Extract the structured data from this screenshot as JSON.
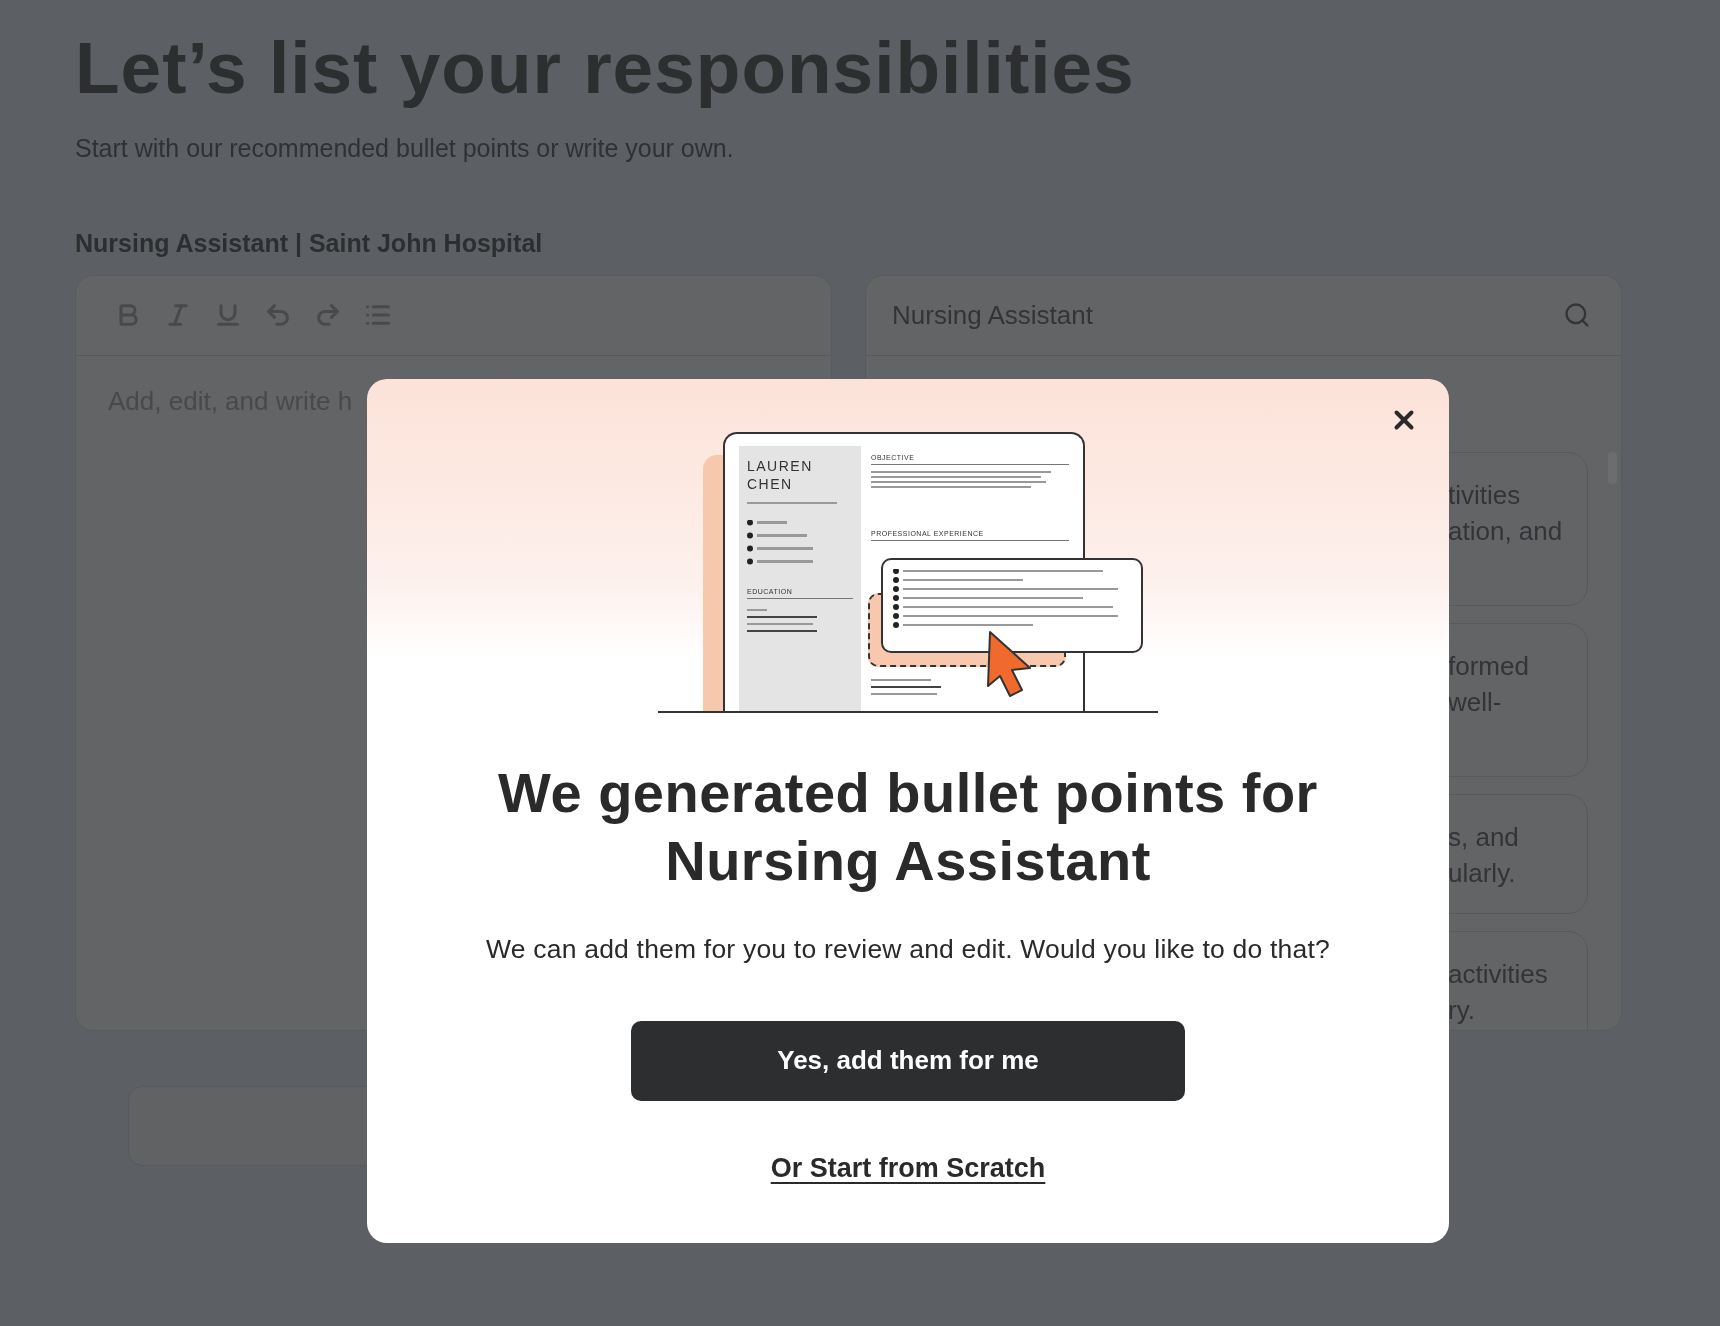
{
  "page": {
    "title": "Let’s list your responsibilities",
    "subtitle": "Start with our recommended bullet points or write your own.",
    "job_label": "Nursing Assistant | Saint John Hospital"
  },
  "editor": {
    "toolbar": [
      {
        "kind": "bold"
      },
      {
        "kind": "italic"
      },
      {
        "kind": "underline"
      },
      {
        "kind": "undo"
      },
      {
        "kind": "redo"
      },
      {
        "kind": "list"
      }
    ],
    "placeholder": "Add, edit, and write h"
  },
  "suggestions": {
    "search_value": "Nursing Assistant",
    "cards": [
      {
        "lines": [
          "tivities",
          "ation, and"
        ]
      },
      {
        "lines": [
          "formed",
          "well-"
        ]
      },
      {
        "lines": [
          "s, and",
          "ularly."
        ]
      },
      {
        "lines": [
          "activities",
          "ry."
        ]
      }
    ]
  },
  "modal": {
    "illustration": {
      "name_lines": [
        "LAUREN",
        "CHEN"
      ],
      "education_heading": "EDUCATION",
      "objective_heading": "OBJECTIVE",
      "experience_heading": "PROFESSIONAL EXPERIENCE"
    },
    "title": "We generated bullet points for Nursing Assistant",
    "message": "We can add them for you to review and edit. Would you like to do that?",
    "primary_button": "Yes, add them for me",
    "secondary_link": "Or Start from Scratch"
  }
}
